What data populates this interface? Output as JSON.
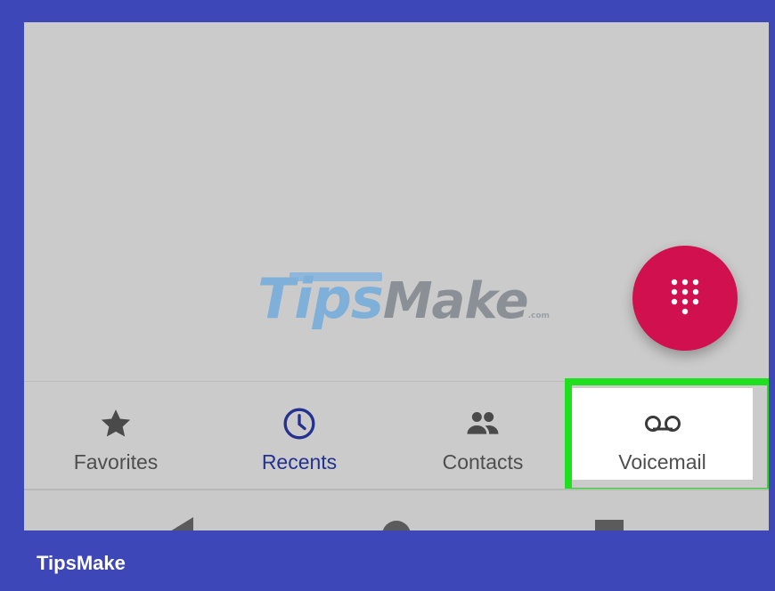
{
  "watermark": {
    "text_main": "Tips",
    "text_accent": "Make",
    "text_suffix": ".com"
  },
  "fab": {
    "icon": "dialpad-icon",
    "color": "#d1104f"
  },
  "tabs": [
    {
      "label": "Favorites",
      "icon": "star-icon",
      "active": false
    },
    {
      "label": "Recents",
      "icon": "clock-icon",
      "active": true
    },
    {
      "label": "Contacts",
      "icon": "contacts-icon",
      "active": false
    },
    {
      "label": "Voicemail",
      "icon": "voicemail-icon",
      "active": false,
      "highlighted": true
    }
  ],
  "colors": {
    "frame": "#3d47b8",
    "highlight": "#1fe01f",
    "active_tab": "#24318e",
    "fab": "#d1104f"
  },
  "navbar": {
    "buttons": [
      "back-icon",
      "home-icon",
      "recents-square-icon"
    ]
  },
  "footer": {
    "brand": "TipsMake"
  }
}
